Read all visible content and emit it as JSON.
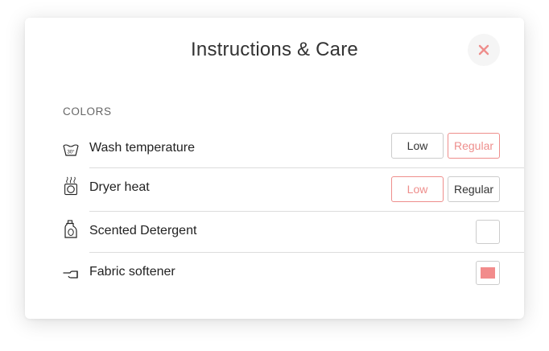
{
  "dialog": {
    "title": "Instructions & Care",
    "close_label": "×",
    "accent_color": "#ee8e8c"
  },
  "section": {
    "label": "COLORS"
  },
  "rows": [
    {
      "label": "Wash temperature",
      "icon": "wash-30-icon",
      "icon_text": "30°",
      "control": "segmented",
      "options": [
        "Low",
        "Regular"
      ],
      "selected": "Regular"
    },
    {
      "label": "Dryer heat",
      "icon": "dryer-icon",
      "control": "segmented",
      "options": [
        "Low",
        "Regular"
      ],
      "selected": "Low"
    },
    {
      "label": "Scented Detergent",
      "icon": "detergent-bottle-icon",
      "control": "checkbox",
      "checked": false
    },
    {
      "label": "Fabric softener",
      "icon": "iron-icon",
      "control": "checkbox",
      "checked": true
    }
  ]
}
